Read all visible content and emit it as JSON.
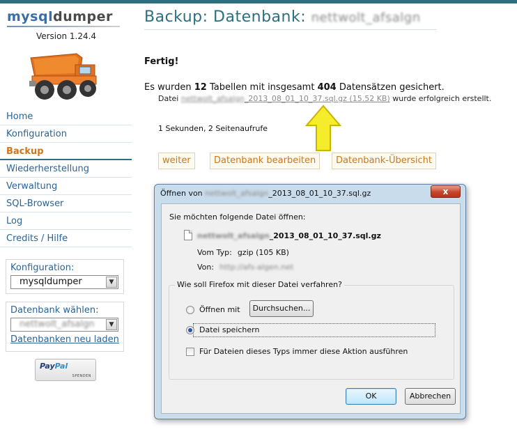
{
  "sidebar": {
    "logo_part1": "mysql",
    "logo_part2": "dumper",
    "version": "Version 1.24.4",
    "nav": [
      {
        "label": "Home"
      },
      {
        "label": "Konfiguration"
      },
      {
        "label": "Backup"
      },
      {
        "label": "Wiederherstellung"
      },
      {
        "label": "Verwaltung"
      },
      {
        "label": "SQL-Browser"
      },
      {
        "label": "Log"
      },
      {
        "label": "Credits / Hilfe"
      }
    ],
    "config_label": "Konfiguration:",
    "config_value": "mysqldumper",
    "db_label": "Datenbank wählen:",
    "db_value": "nettwolt_afsalgn",
    "reload_link": "Datenbanken neu laden",
    "paypal_text1": "Pay",
    "paypal_text2": "Pal",
    "paypal_sub": "SPENDEN"
  },
  "main": {
    "title": "Backup: Datenbank:",
    "title_db": "nettwolt_afsalgn",
    "done": "Fertig!",
    "summary_pre": "Es wurden ",
    "tables_count": "12",
    "summary_mid": " Tabellen mit insgesamt ",
    "records_count": "404",
    "summary_post": " Datensätzen gesichert.",
    "file_pre": "Datei ",
    "file_blur": "nettwolt_afsalgn",
    "file_name": "_2013_08_01_10_37.sql.gz (15.52 KB)",
    "file_post": " wurde erfolgreich erstellt.",
    "stats": "1 Sekunden, 2 Seitenaufrufe",
    "buttons": {
      "weiter": "weiter",
      "edit": "Datenbank bearbeiten",
      "overview": "Datenbank-Übersicht"
    }
  },
  "dialog": {
    "title_pre": "Öffnen von ",
    "title_blur": "nettwolt_afsalgn",
    "title_post": "_2013_08_01_10_37.sql.gz",
    "close": "x",
    "question": "Sie möchten folgende Datei öffnen:",
    "file_blur": "nettwolt_afsalgn",
    "file_name": "_2013_08_01_10_37.sql.gz",
    "type_label": "Vom Typ:",
    "type_value": "gzip (105 KB)",
    "from_label": "Von:",
    "from_value": "http://afs-algen.net",
    "action_question": "Wie soll Firefox mit dieser Datei verfahren?",
    "open_with": "Öffnen mit",
    "browse": "Durchsuchen...",
    "save_file": "Datei speichern",
    "always": "Für Dateien dieses Typs immer diese Aktion ausführen",
    "ok": "OK",
    "cancel": "Abbrechen",
    "selected_option": "save"
  },
  "colors": {
    "accent": "#2e6f7f",
    "link": "#2a6496",
    "active": "#d0761a",
    "arrow": "#f3e32a"
  }
}
